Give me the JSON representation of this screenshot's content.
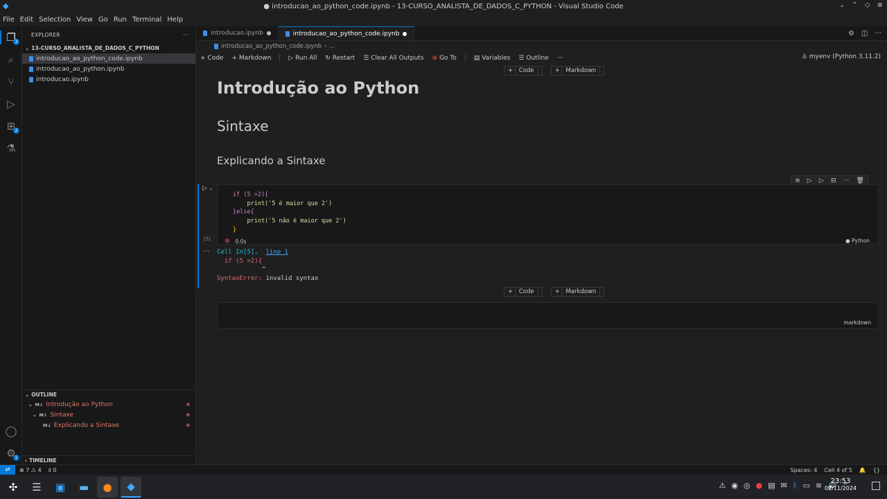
{
  "window": {
    "title": "● introducao_ao_python_code.ipynb - 13-CURSO_ANALISTA_DE_DADOS_C_PYTHON - Visual Studio Code"
  },
  "menu": [
    "File",
    "Edit",
    "Selection",
    "View",
    "Go",
    "Run",
    "Terminal",
    "Help"
  ],
  "explorer": {
    "header": "EXPLORER",
    "folder": "13-CURSO_ANALISTA_DE_DADOS_C_PYTHON",
    "files": [
      "introducao_ao_python_code.ipynb",
      "introducao_ao_python.ipynb",
      "introducao.ipynb"
    ]
  },
  "outline": {
    "header": "OUTLINE",
    "items": [
      "Introdução ao Python",
      "Sintaxe",
      "Explicando a Sintaxe"
    ],
    "md_tag": "M↓"
  },
  "timeline": {
    "header": "TIMELINE"
  },
  "activity_badges": {
    "explorer": "3",
    "extensions": "2",
    "settings": "1"
  },
  "tabs": [
    {
      "label": "introducao.ipynb"
    },
    {
      "label": "introducao_ao_python_code.ipynb"
    }
  ],
  "breadcrumb": {
    "file": "introducao_ao_python_code.ipynb",
    "rest": "..."
  },
  "toolbar": {
    "code": "Code",
    "markdown": "Markdown",
    "run_all": "Run All",
    "restart": "Restart",
    "clear": "Clear All Outputs",
    "goto": "Go To",
    "variables": "Variables",
    "outline": "Outline",
    "more": "···",
    "kernel": "myenv (Python 3.11.2)"
  },
  "add_cell": {
    "code": "Code",
    "markdown": "Markdown"
  },
  "markdown": {
    "h1": "Introdução ao Python",
    "h2": "Sintaxe",
    "h3": "Explicando a Sintaxe"
  },
  "code_cell": {
    "lines": [
      "if (5 >2){",
      "    print('5 é maior que 2')",
      "}else{",
      "    print('5 não é maior que 2')",
      "}"
    ],
    "exec_count": "[5]",
    "time": "0.0s",
    "language": "Python"
  },
  "output": {
    "cell_ref": "Cell In[5],",
    "line_link": "line 1",
    "code_line": "if (5 >2){",
    "caret": "^",
    "error_type": "SyntaxError:",
    "error_msg": "invalid syntax"
  },
  "md_cell": {
    "language": "markdown"
  },
  "status": {
    "errors": "7",
    "warnings": "4",
    "ports": "0",
    "spaces": "Spaces: 4",
    "cell": "Cell 4 of 5",
    "braces": "{}"
  },
  "taskbar": {
    "time": "23:53",
    "date": "02/11/2024"
  },
  "colors": {
    "accent": "#0078d4",
    "error": "#f14c4c"
  }
}
